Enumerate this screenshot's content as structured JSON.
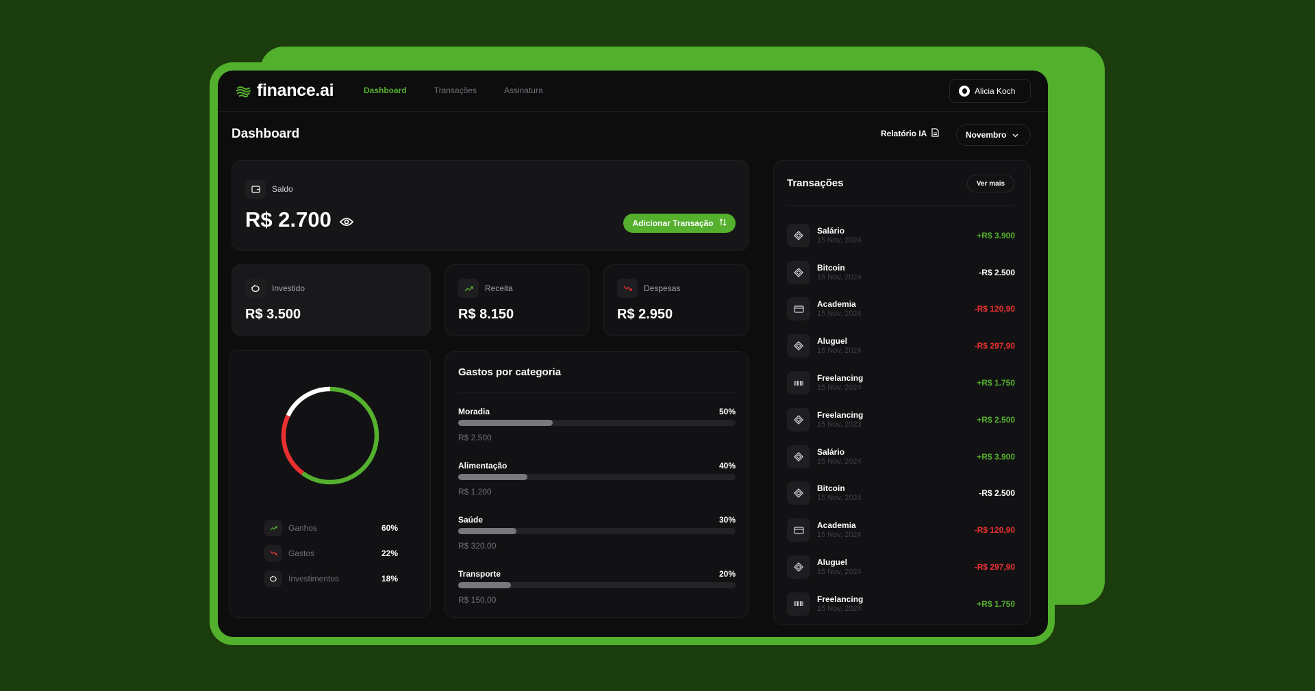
{
  "brand": {
    "name": "finance.ai"
  },
  "nav": {
    "items": [
      {
        "label": "Dashboard",
        "active": true
      },
      {
        "label": "Transações",
        "active": false
      },
      {
        "label": "Assinatura",
        "active": false
      }
    ]
  },
  "user": {
    "name": "Alicia Koch"
  },
  "page": {
    "title": "Dashboard",
    "report_label": "Relatório IA",
    "month": "Novembro"
  },
  "balance": {
    "label": "Saldo",
    "value": "R$ 2.700",
    "add_button": "Adicionar Transação"
  },
  "stats": [
    {
      "label": "Investido",
      "value": "R$ 3.500"
    },
    {
      "label": "Receita",
      "value": "R$ 8.150"
    },
    {
      "label": "Despesas",
      "value": "R$ 2.950"
    }
  ],
  "donut": {
    "segments": [
      {
        "label": "Ganhos",
        "pct": "60%",
        "fraction": 0.6,
        "color": "#55b02e"
      },
      {
        "label": "Gastos",
        "pct": "22%",
        "fraction": 0.22,
        "color": "#e93030"
      },
      {
        "label": "Investimentos",
        "pct": "18%",
        "fraction": 0.18,
        "color": "#ffffff"
      }
    ]
  },
  "categories": {
    "title": "Gastos por categoria",
    "items": [
      {
        "name": "Moradia",
        "pct": "50%",
        "fill": 0.34,
        "amount": "R$ 2.500"
      },
      {
        "name": "Alimentação",
        "pct": "40%",
        "fill": 0.25,
        "amount": "R$ 1.200"
      },
      {
        "name": "Saúde",
        "pct": "30%",
        "fill": 0.21,
        "amount": "R$ 320,00"
      },
      {
        "name": "Transporte",
        "pct": "20%",
        "fill": 0.19,
        "amount": "R$ 150,00"
      }
    ]
  },
  "transactions": {
    "title": "Transações",
    "more_label": "Ver mais",
    "items": [
      {
        "name": "Salário",
        "date": "15 Nov, 2024",
        "amount": "+R$ 3.900",
        "kind": "pos",
        "icon": "pix-icon"
      },
      {
        "name": "Bitcoin",
        "date": "15 Nov, 2024",
        "amount": "-R$ 2.500",
        "kind": "neu",
        "icon": "pix-icon"
      },
      {
        "name": "Academia",
        "date": "15 Nov, 2024",
        "amount": "-R$ 120,90",
        "kind": "neg",
        "icon": "credit-card-icon"
      },
      {
        "name": "Aluguel",
        "date": "15 Nov, 2024",
        "amount": "-R$ 297,90",
        "kind": "neg",
        "icon": "pix-icon"
      },
      {
        "name": "Freelancing",
        "date": "15 Nov, 2024",
        "amount": "+R$ 1.750",
        "kind": "pos",
        "icon": "barcode-icon"
      },
      {
        "name": "Freelancing",
        "date": "15 Nov, 2023",
        "amount": "+R$ 2.500",
        "kind": "pos",
        "icon": "pix-icon"
      },
      {
        "name": "Salário",
        "date": "15 Nov, 2024",
        "amount": "+R$ 3.900",
        "kind": "pos",
        "icon": "pix-icon"
      },
      {
        "name": "Bitcoin",
        "date": "15 Nov, 2024",
        "amount": "-R$ 2.500",
        "kind": "neu",
        "icon": "pix-icon"
      },
      {
        "name": "Academia",
        "date": "15 Nov, 2024",
        "amount": "-R$ 120,90",
        "kind": "neg",
        "icon": "credit-card-icon"
      },
      {
        "name": "Aluguel",
        "date": "15 Nov, 2024",
        "amount": "-R$ 297,90",
        "kind": "neg",
        "icon": "pix-icon"
      },
      {
        "name": "Freelancing",
        "date": "15 Nov, 2024",
        "amount": "+R$ 1.750",
        "kind": "pos",
        "icon": "barcode-icon"
      }
    ]
  },
  "colors": {
    "accent": "#55b02e",
    "negative": "#e93030",
    "background": "#1b3c0c",
    "panel": "#0d0d0e"
  }
}
